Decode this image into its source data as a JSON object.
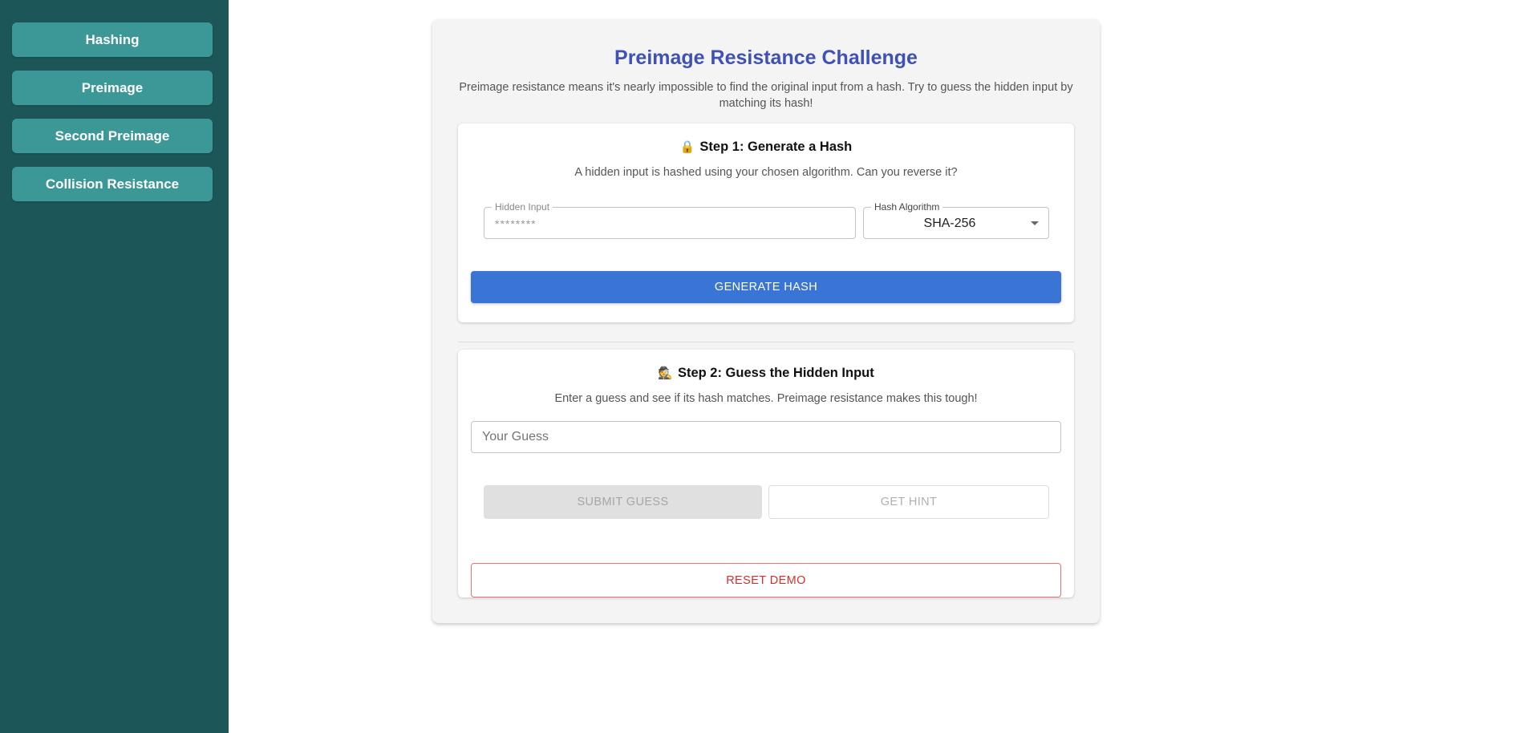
{
  "sidebar": {
    "items": [
      {
        "label": "Hashing"
      },
      {
        "label": "Preimage"
      },
      {
        "label": "Second Preimage"
      },
      {
        "label": "Collision Resistance"
      }
    ]
  },
  "main": {
    "title": "Preimage Resistance Challenge",
    "intro": "Preimage resistance means it's nearly impossible to find the original input from a hash. Try to guess the hidden input by matching its hash!",
    "step1": {
      "icon": "lock-icon",
      "icon_glyph": "🔒",
      "title": "Step 1: Generate a Hash",
      "description": "A hidden input is hashed using your chosen algorithm. Can you reverse it?",
      "hidden_input": {
        "label": "Hidden Input",
        "value": "********"
      },
      "algorithm": {
        "label": "Hash Algorithm",
        "selected": "SHA-256"
      },
      "generate_label": "GENERATE HASH"
    },
    "step2": {
      "icon": "detective-icon",
      "icon_glyph": "🕵",
      "title": "Step 2: Guess the Hidden Input",
      "description": "Enter a guess and see if its hash matches. Preimage resistance makes this tough!",
      "guess_placeholder": "Your Guess",
      "submit_label": "SUBMIT GUESS",
      "hint_label": "GET HINT",
      "reset_label": "RESET DEMO"
    }
  },
  "colors": {
    "sidebar_bg": "#1c5658",
    "nav_button": "#3c9896",
    "title": "#3f51b5",
    "primary_button": "#3a74d4",
    "danger": "#d32f2f"
  }
}
